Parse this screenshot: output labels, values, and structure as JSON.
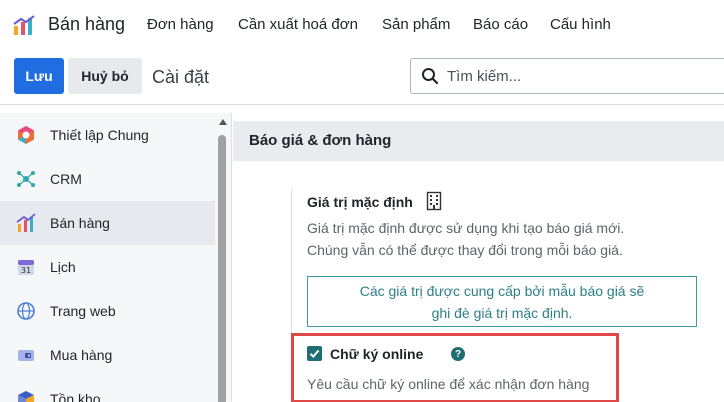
{
  "topbar": {
    "app_name": "Bán hàng",
    "menu": [
      "Đơn hàng",
      "Cần xuất hoá đơn",
      "Sản phẩm",
      "Báo cáo",
      "Cấu hình"
    ]
  },
  "control_panel": {
    "save_label": "Lưu",
    "discard_label": "Huỷ bỏ",
    "title": "Cài đặt",
    "search_placeholder": "Tìm kiếm..."
  },
  "sidebar": {
    "items": [
      {
        "label": "Thiết lập Chung",
        "icon": "settings-app-icon"
      },
      {
        "label": "CRM",
        "icon": "crm-app-icon"
      },
      {
        "label": "Bán hàng",
        "icon": "sales-app-icon",
        "active": true
      },
      {
        "label": "Lịch",
        "icon": "calendar-app-icon"
      },
      {
        "label": "Trang web",
        "icon": "website-app-icon"
      },
      {
        "label": "Mua hàng",
        "icon": "purchase-app-icon"
      },
      {
        "label": "Tồn kho",
        "icon": "inventory-app-icon"
      }
    ]
  },
  "section": {
    "title": "Báo giá & đơn hàng",
    "default_values": {
      "title": "Giá trị mặc định",
      "desc_line1": "Giá trị mặc định được sử dụng khi tạo báo giá mới.",
      "desc_line2": "Chúng vẫn có thể được thay đổi trong mỗi báo giá.",
      "info_line1": "Các giá trị được cung cấp bởi mẫu báo giá sẽ",
      "info_line2": "ghi đè giá trị mặc định."
    },
    "online_signature": {
      "label": "Chữ ký online",
      "checked": true,
      "help": "?",
      "desc": "Yêu cầu chữ ký online để xác nhận đơn hàng"
    }
  },
  "colors": {
    "primary": "#1f6de0",
    "teal": "#1f6e73",
    "highlight": "#e04747"
  }
}
